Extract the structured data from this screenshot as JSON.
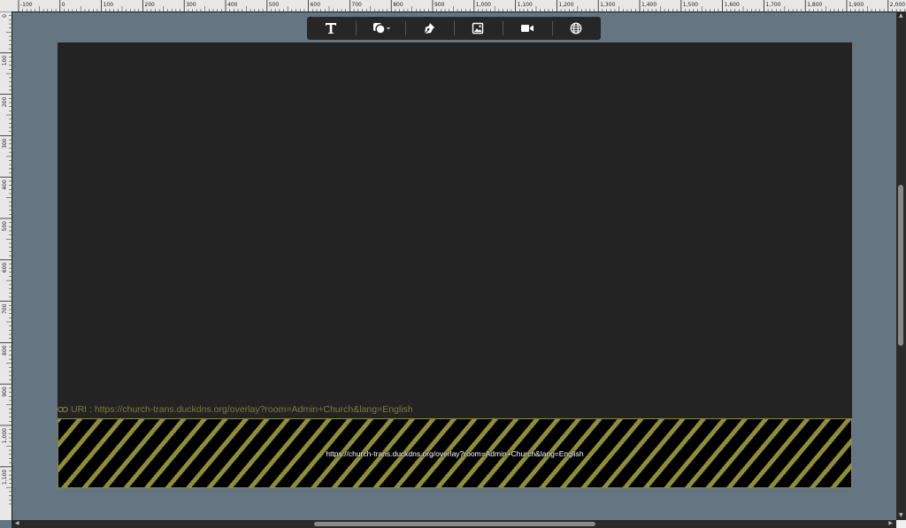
{
  "ruler": {
    "top_labels": [
      "-100",
      "0",
      "100",
      "200",
      "300",
      "400",
      "500",
      "600",
      "700",
      "800",
      "900",
      "1,000",
      "1,100",
      "1,200",
      "1,300",
      "1,400",
      "1,500",
      "1,600",
      "1,700",
      "1,800",
      "1,900",
      "2,000"
    ],
    "left_labels": [
      "0",
      "100",
      "200",
      "300",
      "400",
      "500",
      "600",
      "700",
      "800",
      "900",
      "1,000",
      "1,100"
    ]
  },
  "toolbar": {
    "tools": [
      {
        "name": "text-tool",
        "icon": "text-icon"
      },
      {
        "name": "shape-tool",
        "icon": "shapes-icon"
      },
      {
        "name": "pen-tool",
        "icon": "pen-icon"
      },
      {
        "name": "image-tool",
        "icon": "image-icon"
      },
      {
        "name": "video-tool",
        "icon": "video-icon"
      },
      {
        "name": "web-tool",
        "icon": "globe-icon"
      }
    ]
  },
  "canvas": {
    "background": "#232323"
  },
  "uri_label": {
    "icon": "link-icon",
    "text": "URI : https://church-trans.duckdns.org/overlay?room=Admin+Church&lang=English"
  },
  "overlay": {
    "url_text": "https://church-trans.duckdns.org/overlay?room=Admin+Church&lang=English",
    "stripe_color": "#8f8d3a"
  },
  "colors": {
    "workspace_bg": "#667582",
    "toolbar_bg": "#262626",
    "uri_text": "#7b7c3b"
  }
}
